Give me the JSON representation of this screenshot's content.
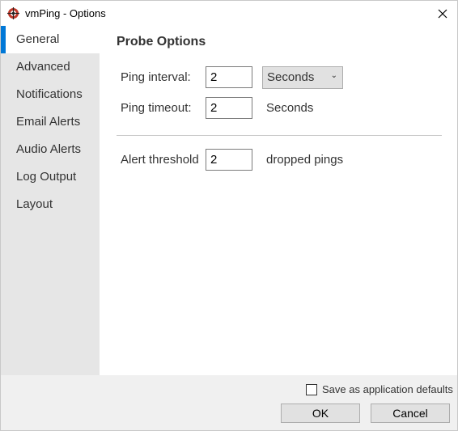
{
  "window": {
    "title": "vmPing - Options"
  },
  "sidebar": {
    "items": [
      {
        "label": "General"
      },
      {
        "label": "Advanced"
      },
      {
        "label": "Notifications"
      },
      {
        "label": "Email Alerts"
      },
      {
        "label": "Audio Alerts"
      },
      {
        "label": "Log Output"
      },
      {
        "label": "Layout"
      }
    ],
    "selected": "General"
  },
  "probe": {
    "heading": "Probe Options",
    "interval_label": "Ping interval:",
    "interval_value": "2",
    "interval_unit": "Seconds",
    "timeout_label": "Ping timeout:",
    "timeout_value": "2",
    "timeout_unit": "Seconds",
    "threshold_label": "Alert threshold",
    "threshold_value": "2",
    "threshold_unit": "dropped pings"
  },
  "footer": {
    "save_defaults_label": "Save as application defaults",
    "save_defaults_checked": false,
    "ok_label": "OK",
    "cancel_label": "Cancel"
  },
  "colors": {
    "accent": "#0078d7",
    "sidebar_bg": "#e6e6e6",
    "footer_bg": "#f0f0f0",
    "icon_red": "#c0392b"
  },
  "icons": {
    "app": "target-icon",
    "close": "close-icon",
    "dropdown": "chevron-down-icon"
  }
}
